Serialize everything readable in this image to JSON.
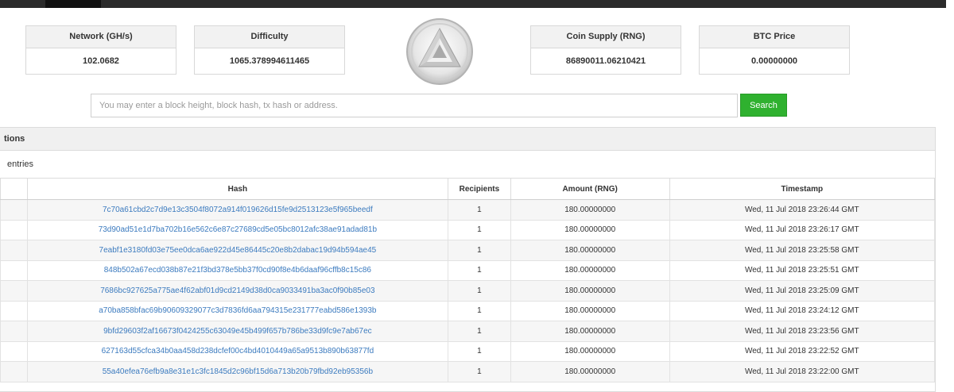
{
  "stats": [
    {
      "label": "Network (GH/s)",
      "value": "102.0682"
    },
    {
      "label": "Difficulty",
      "value": "1065.378994611465"
    },
    {
      "label": "Coin Supply (RNG)",
      "value": "86890011.06210421"
    },
    {
      "label": "BTC Price",
      "value": "0.00000000"
    }
  ],
  "logo": {
    "icon": "triangle-logo-icon"
  },
  "search": {
    "placeholder": "You may enter a block height, block hash, tx hash or address.",
    "value": "",
    "button_label": "Search",
    "button_color": "#2fb12f"
  },
  "panel": {
    "title_fragment": "tions",
    "entries_fragment": "entries"
  },
  "table": {
    "columns": [
      "",
      "Hash",
      "Recipients",
      "Amount (RNG)",
      "Timestamp"
    ],
    "link_color": "#3c7bbf",
    "rows": [
      {
        "hash": "7c70a61cbd2c7d9e13c3504f8072a914f019626d15fe9d2513123e5f965beedf",
        "recipients": "1",
        "amount": "180.00000000",
        "timestamp": "Wed, 11 Jul 2018 23:26:44 GMT"
      },
      {
        "hash": "73d90ad51e1d7ba702b16e562c6e87c27689cd5e05bc8012afc38ae91adad81b",
        "recipients": "1",
        "amount": "180.00000000",
        "timestamp": "Wed, 11 Jul 2018 23:26:17 GMT"
      },
      {
        "hash": "7eabf1e3180fd03e75ee0dca6ae922d45e86445c20e8b2dabac19d94b594ae45",
        "recipients": "1",
        "amount": "180.00000000",
        "timestamp": "Wed, 11 Jul 2018 23:25:58 GMT"
      },
      {
        "hash": "848b502a67ecd038b87e21f3bd378e5bb37f0cd90f8e4b6daaf96cffb8c15c86",
        "recipients": "1",
        "amount": "180.00000000",
        "timestamp": "Wed, 11 Jul 2018 23:25:51 GMT"
      },
      {
        "hash": "7686bc927625a775ae4f62abf01d9cd2149d38d0ca9033491ba3ac0f90b85e03",
        "recipients": "1",
        "amount": "180.00000000",
        "timestamp": "Wed, 11 Jul 2018 23:25:09 GMT"
      },
      {
        "hash": "a70ba858bfac69b90609329077c3d7836fd6aa794315e231777eabd586e1393b",
        "recipients": "1",
        "amount": "180.00000000",
        "timestamp": "Wed, 11 Jul 2018 23:24:12 GMT"
      },
      {
        "hash": "9bfd29603f2af16673f0424255c63049e45b499f657b786be33d9fc9e7ab67ec",
        "recipients": "1",
        "amount": "180.00000000",
        "timestamp": "Wed, 11 Jul 2018 23:23:56 GMT"
      },
      {
        "hash": "627163d55cfca34b0aa458d238dcfef00c4bd4010449a65a9513b890b63877fd",
        "recipients": "1",
        "amount": "180.00000000",
        "timestamp": "Wed, 11 Jul 2018 23:22:52 GMT"
      },
      {
        "hash": "55a40efea76efb9a8e31e1c3fc1845d2c96bf15d6a713b20b79fbd92eb95356b",
        "recipients": "1",
        "amount": "180.00000000",
        "timestamp": "Wed, 11 Jul 2018 23:22:00 GMT"
      }
    ]
  }
}
